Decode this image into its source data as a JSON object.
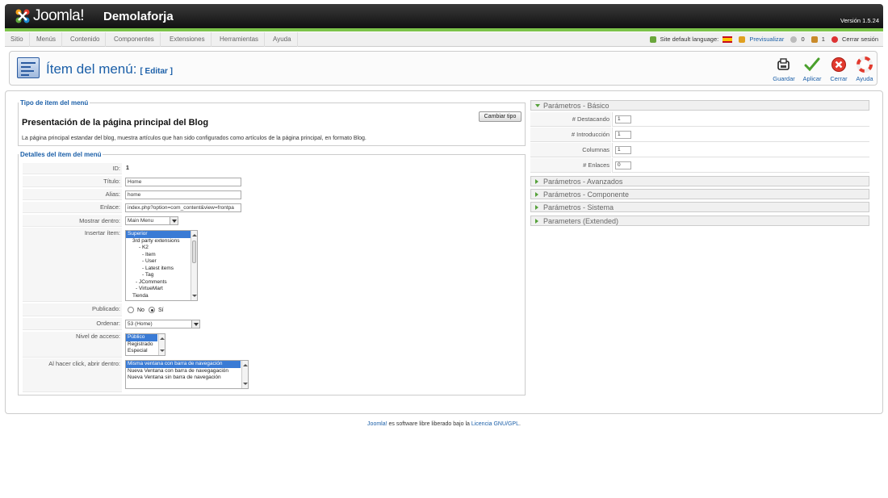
{
  "header": {
    "logo_text": "Joomla!",
    "site_name": "Demolaforja",
    "version": "Versión 1.5.24"
  },
  "menubar": {
    "items": [
      "Sitio",
      "Menús",
      "Contenido",
      "Componentes",
      "Extensiones",
      "Herramientas",
      "Ayuda"
    ],
    "language_label": "Site default language:",
    "preview": "Previsualizar",
    "count_a": "0",
    "count_b": "1",
    "logout": "Cerrar sesión"
  },
  "toolbar": {
    "title": "Ítem del menú:",
    "subtitle": "[ Editar ]",
    "save": "Guardar",
    "apply": "Aplicar",
    "close": "Cerrar",
    "help": "Ayuda"
  },
  "type_section": {
    "legend": "Tipo de item del menú",
    "title": "Presentación de la página principal del Blog",
    "description": "La página principal estandar del blog, muestra artículos que han sido configurados como artículos de la página principal, en formato Blog.",
    "change_button": "Cambiar tipo"
  },
  "details": {
    "legend": "Detalles del ítem del menú",
    "id_label": "ID:",
    "id_value": "1",
    "title_label": "Título:",
    "title_value": "Home",
    "alias_label": "Alias:",
    "alias_value": "home",
    "link_label": "Enlace:",
    "link_value": "index.php?option=com_content&view=frontpa",
    "show_in_label": "Mostrar dentro:",
    "show_in_value": "Main Menu",
    "parent_label": "Insertar ítem:",
    "parent_options": [
      "Superior",
      "3rd party extensions",
      "- K2",
      "- Item",
      "- User",
      "- Latest items",
      "- Tag",
      "- JComments",
      "- VirtueMart",
      "Tienda"
    ],
    "published_label": "Publicado:",
    "published_no": "No",
    "published_yes": "Sí",
    "order_label": "Ordenar:",
    "order_value": "53 (Home)",
    "access_label": "Nivel de acceso:",
    "access_options": [
      "Público",
      "Registrado",
      "Especial"
    ],
    "target_label": "Al hacer click, abrir dentro:",
    "target_options": [
      "Misma ventana con barra de navegación",
      "Nueva Ventana con barra de navegagación",
      "Nueva Ventana sin barra de navegación"
    ]
  },
  "params": {
    "basic_title": "Parámetros - Básico",
    "rows": [
      {
        "label": "# Destacando",
        "value": "1"
      },
      {
        "label": "# Introducción",
        "value": "1"
      },
      {
        "label": "Columnas",
        "value": "1"
      },
      {
        "label": "# Enlaces",
        "value": "0"
      }
    ],
    "advanced": "Parámetros - Avanzados",
    "component": "Parámetros - Componente",
    "system": "Parámetros - Sistema",
    "extended": "Parameters (Extended)"
  },
  "footer": {
    "link_joomla": "Joomla!",
    "text": " es software libre liberado bajo la ",
    "link_license": "Licencia GNU/GPL",
    "end": "."
  },
  "colors": {
    "accent": "#1b5fa8",
    "green": "#7cc34a",
    "selected": "#3a7bd5"
  }
}
